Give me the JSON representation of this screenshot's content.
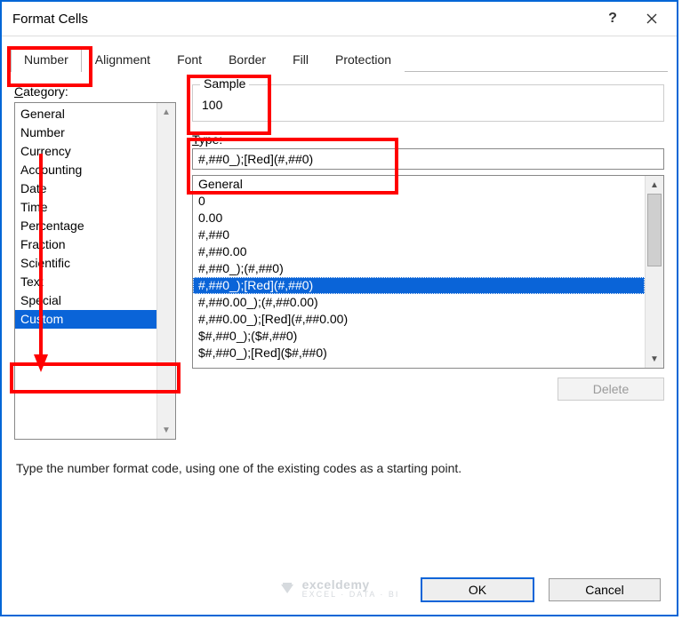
{
  "title": "Format Cells",
  "tabs": [
    "Number",
    "Alignment",
    "Font",
    "Border",
    "Fill",
    "Protection"
  ],
  "active_tab": "Number",
  "category_label": "Category:",
  "categories": [
    "General",
    "Number",
    "Currency",
    "Accounting",
    "Date",
    "Time",
    "Percentage",
    "Fraction",
    "Scientific",
    "Text",
    "Special",
    "Custom"
  ],
  "selected_category": "Custom",
  "sample_label": "Sample",
  "sample_value": "100",
  "type_label": "Type:",
  "type_value": "#,##0_);[Red](#,##0)",
  "formats": [
    "General",
    "0",
    "0.00",
    "#,##0",
    "#,##0.00",
    "#,##0_);(#,##0)",
    "#,##0_);[Red](#,##0)",
    "#,##0.00_);(#,##0.00)",
    "#,##0.00_);[Red](#,##0.00)",
    "$#,##0_);($#,##0)",
    "$#,##0_);[Red]($#,##0)"
  ],
  "selected_format_index": 6,
  "delete_label": "Delete",
  "hint": "Type the number format code, using one of the existing codes as a starting point.",
  "ok_label": "OK",
  "cancel_label": "Cancel",
  "watermark_name": "exceldemy",
  "watermark_tag": "EXCEL · DATA · BI",
  "highlight_color": "#f00"
}
